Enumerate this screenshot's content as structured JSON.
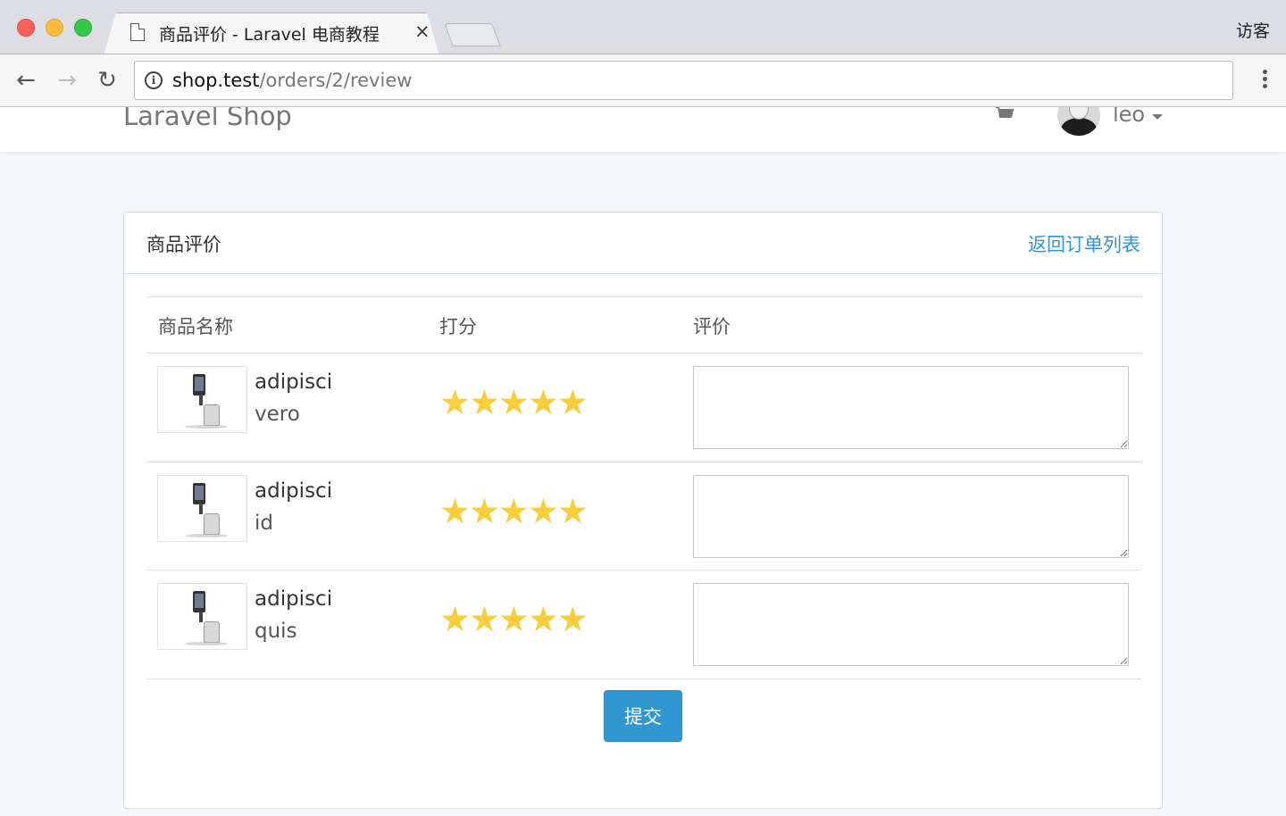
{
  "browser": {
    "tab_title": "商品评价 - Laravel 电商教程",
    "tab_close": "×",
    "user_label": "访客",
    "url_host": "shop.test",
    "url_path": "/orders/2/review",
    "info_glyph": "i",
    "back_glyph": "←",
    "forward_glyph": "→",
    "reload_glyph": "↻"
  },
  "navbar": {
    "brand": "Laravel Shop",
    "username": "leo",
    "cart_icon": "cart-icon",
    "avatar": "avatar"
  },
  "panel": {
    "title": "商品评价",
    "back_link": "返回订单列表"
  },
  "table": {
    "headers": {
      "name": "商品名称",
      "score": "打分",
      "review": "评价"
    },
    "rows": [
      {
        "title": "adipisci",
        "sku": "vero",
        "rating": 5,
        "stars": "★★★★★",
        "review": ""
      },
      {
        "title": "adipisci",
        "sku": "id",
        "rating": 5,
        "stars": "★★★★★",
        "review": ""
      },
      {
        "title": "adipisci",
        "sku": "quis",
        "rating": 5,
        "stars": "★★★★★",
        "review": ""
      }
    ]
  },
  "form": {
    "submit_label": "提交"
  },
  "colors": {
    "accent": "#3097d1",
    "star": "#f8ce3a",
    "page_bg": "#f5f8fa"
  }
}
